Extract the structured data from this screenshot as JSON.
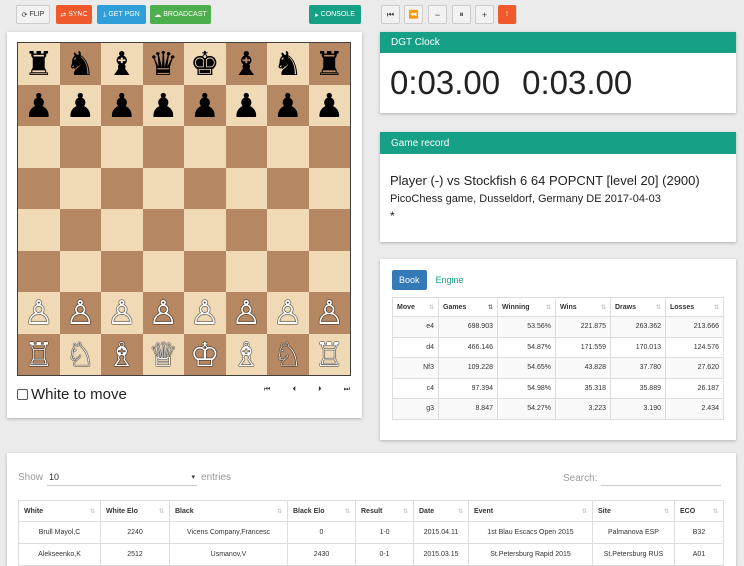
{
  "toolbar": {
    "flip": "FLIP",
    "sync": "SYNC",
    "get_pgn": "GET PGN",
    "broadcast": "BROADCAST",
    "console": "CONSOLE"
  },
  "nav": {
    "first": "⏮",
    "back": "⏪",
    "minus": "−",
    "pause": "⏸",
    "plus": "+",
    "forward": "⏩",
    "last": "!"
  },
  "board": {
    "rank8": [
      "♜",
      "♞",
      "♝",
      "♛",
      "♚",
      "♝",
      "♞",
      "♜"
    ],
    "rank7": [
      "♟",
      "♟",
      "♟",
      "♟",
      "♟",
      "♟",
      "♟",
      "♟"
    ],
    "rank2": [
      "♙",
      "♙",
      "♙",
      "♙",
      "♙",
      "♙",
      "♙",
      "♙"
    ],
    "rank1": [
      "♖",
      "♘",
      "♗",
      "♕",
      "♔",
      "♗",
      "♘",
      "♖"
    ],
    "to_move": "White to move",
    "buttons": [
      "⏮",
      "⏴",
      "⏵",
      "⏭"
    ]
  },
  "clock": {
    "title": "DGT Clock",
    "white_time": "0:03.00",
    "black_time": "0:03.00"
  },
  "game_record": {
    "title": "Game record",
    "players": "Player (-) vs Stockfish 6 64 POPCNT [level 20] (2900)",
    "event": "PicoChess game, Dusseldorf, Germany DE 2017-04-03",
    "moves": "*"
  },
  "book": {
    "tabs": [
      "Book",
      "Engine"
    ],
    "columns": [
      "Move",
      "Games",
      "Winning",
      "Wins",
      "Draws",
      "Losses"
    ],
    "rows": [
      [
        "e4",
        "698.903",
        "53.56%",
        "221.875",
        "263.362",
        "213.666"
      ],
      [
        "d4",
        "466.146",
        "54.87%",
        "171.559",
        "170.013",
        "124.576"
      ],
      [
        "Nf3",
        "109.228",
        "54.65%",
        "43.828",
        "37.780",
        "27.620"
      ],
      [
        "c4",
        "97.394",
        "54.98%",
        "35.318",
        "35.889",
        "26.187"
      ],
      [
        "g3",
        "8.847",
        "54.27%",
        "3.223",
        "3.190",
        "2.434"
      ]
    ]
  },
  "games": {
    "show_label": "Show",
    "show_value": "10",
    "entries_label": "entries",
    "search_label": "Search:",
    "columns": [
      "White",
      "White Elo",
      "Black",
      "Black Elo",
      "Result",
      "Date",
      "Event",
      "Site",
      "ECO"
    ],
    "rows": [
      [
        "Brull Mayol,C",
        "2240",
        "Vicens Company,Francesc",
        "0",
        "1-0",
        "2015.04.11",
        "1st Blau Escacs Open 2015",
        "Palmanova ESP",
        "B32"
      ],
      [
        "Alekseenko,K",
        "2512",
        "Usmanov,V",
        "2430",
        "0-1",
        "2015.03.15",
        "St.Petersburg Rapid 2015",
        "St.Petersburg RUS",
        "A01"
      ]
    ]
  },
  "colors": {
    "accent": "#16a085",
    "orange": "#f0592b",
    "blue": "#2e9fd8",
    "green": "#4cae4c",
    "light_square": "#f0d9b5",
    "dark_square": "#b58863"
  }
}
